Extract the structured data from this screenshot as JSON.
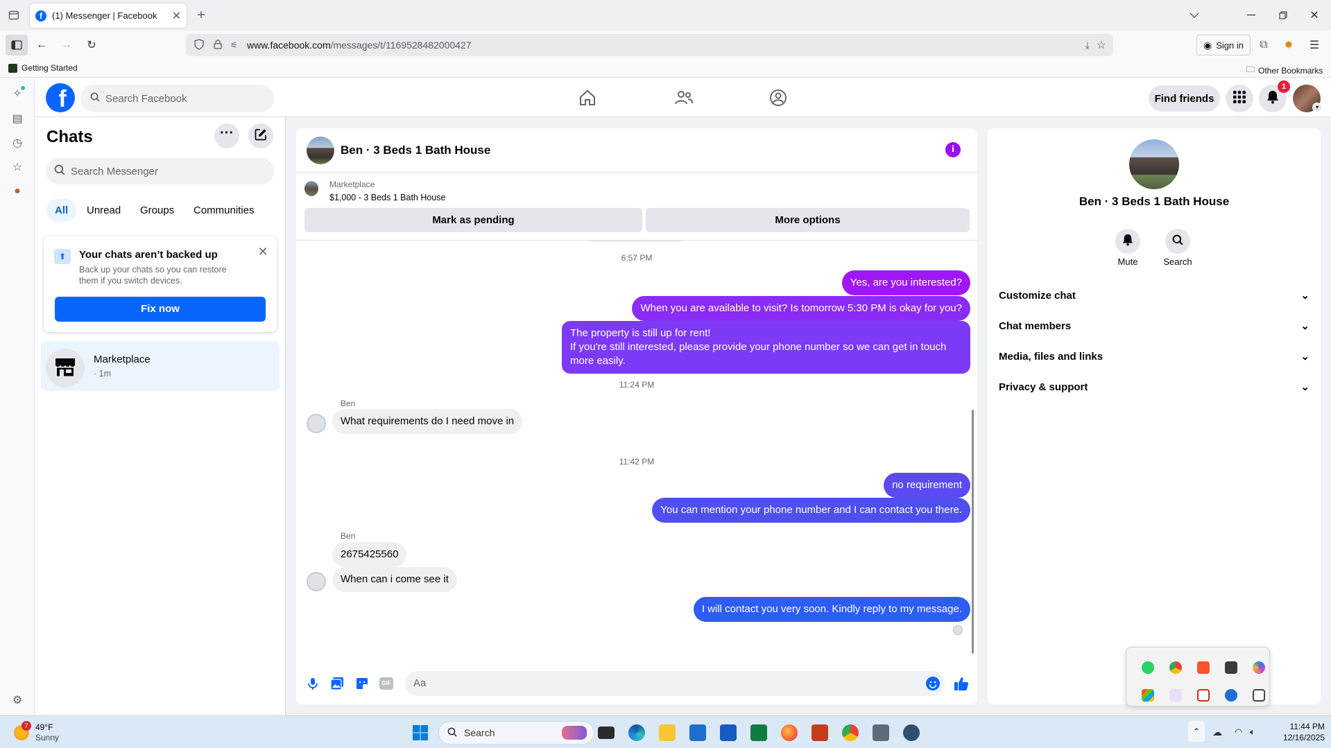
{
  "browser": {
    "tab_title": "(1) Messenger | Facebook",
    "url_domain": "www.facebook.com",
    "url_path": "/messages/t/1169528482000427",
    "sign_in": "Sign in",
    "bookmark_getting_started": "Getting Started",
    "bookmark_other": "Other Bookmarks"
  },
  "fb": {
    "search_placeholder": "Search Facebook",
    "find_friends": "Find friends",
    "notification_count": "1",
    "brand_color": "#0866ff"
  },
  "chats": {
    "title": "Chats",
    "search_placeholder": "Search Messenger",
    "filters": [
      "All",
      "Unread",
      "Groups",
      "Communities"
    ],
    "backup_title": "Your chats aren’t backed up",
    "backup_text": "Back up your chats so you can restore them if you switch devices.",
    "fix_now": "Fix now",
    "list": [
      {
        "name": "Marketplace",
        "time": "· 1m"
      }
    ]
  },
  "conversation": {
    "title": "Ben · 3 Beds 1 Bath House",
    "marketplace_label": "Marketplace",
    "listing": "$1,000 - 3 Beds 1 Bath House",
    "mark_pending": "Mark as pending",
    "more_options": "More options",
    "composer_placeholder": "Aa",
    "timestamps": [
      "6:57 PM",
      "11:24 PM",
      "11:42 PM"
    ],
    "sender_name": "Ben",
    "messages_out_1": [
      "Yes, are you interested?",
      "When you are available to visit? Is tomorrow 5:30 PM is okay for you?",
      "The property is still up for rent!\nIf you're still interested, please provide your phone number so we can get in touch more easily."
    ],
    "message_in_1": "What requirements do I need move in",
    "messages_out_2": [
      "no requirement",
      "You can mention your phone number and I can contact you there."
    ],
    "messages_in_2": [
      "2675425560",
      "When can i come see it"
    ],
    "message_out_3": "I will contact you very soon. Kindly reply to my message.",
    "out_colors": [
      "#a017f5",
      "#8a2cf5",
      "#7c3af5",
      "#5b4af2",
      "#4f4ff0",
      "#2d5df2"
    ]
  },
  "info_panel": {
    "name": "Ben · 3 Beds 1 Bath House",
    "mute": "Mute",
    "search": "Search",
    "sections": [
      "Customize chat",
      "Chat members",
      "Media, files and links",
      "Privacy & support"
    ]
  },
  "taskbar": {
    "temp": "49°F",
    "weather": "Sunny",
    "weather_badge": "7",
    "search": "Search",
    "time": "11:44 PM",
    "date": "12/16/2025"
  }
}
